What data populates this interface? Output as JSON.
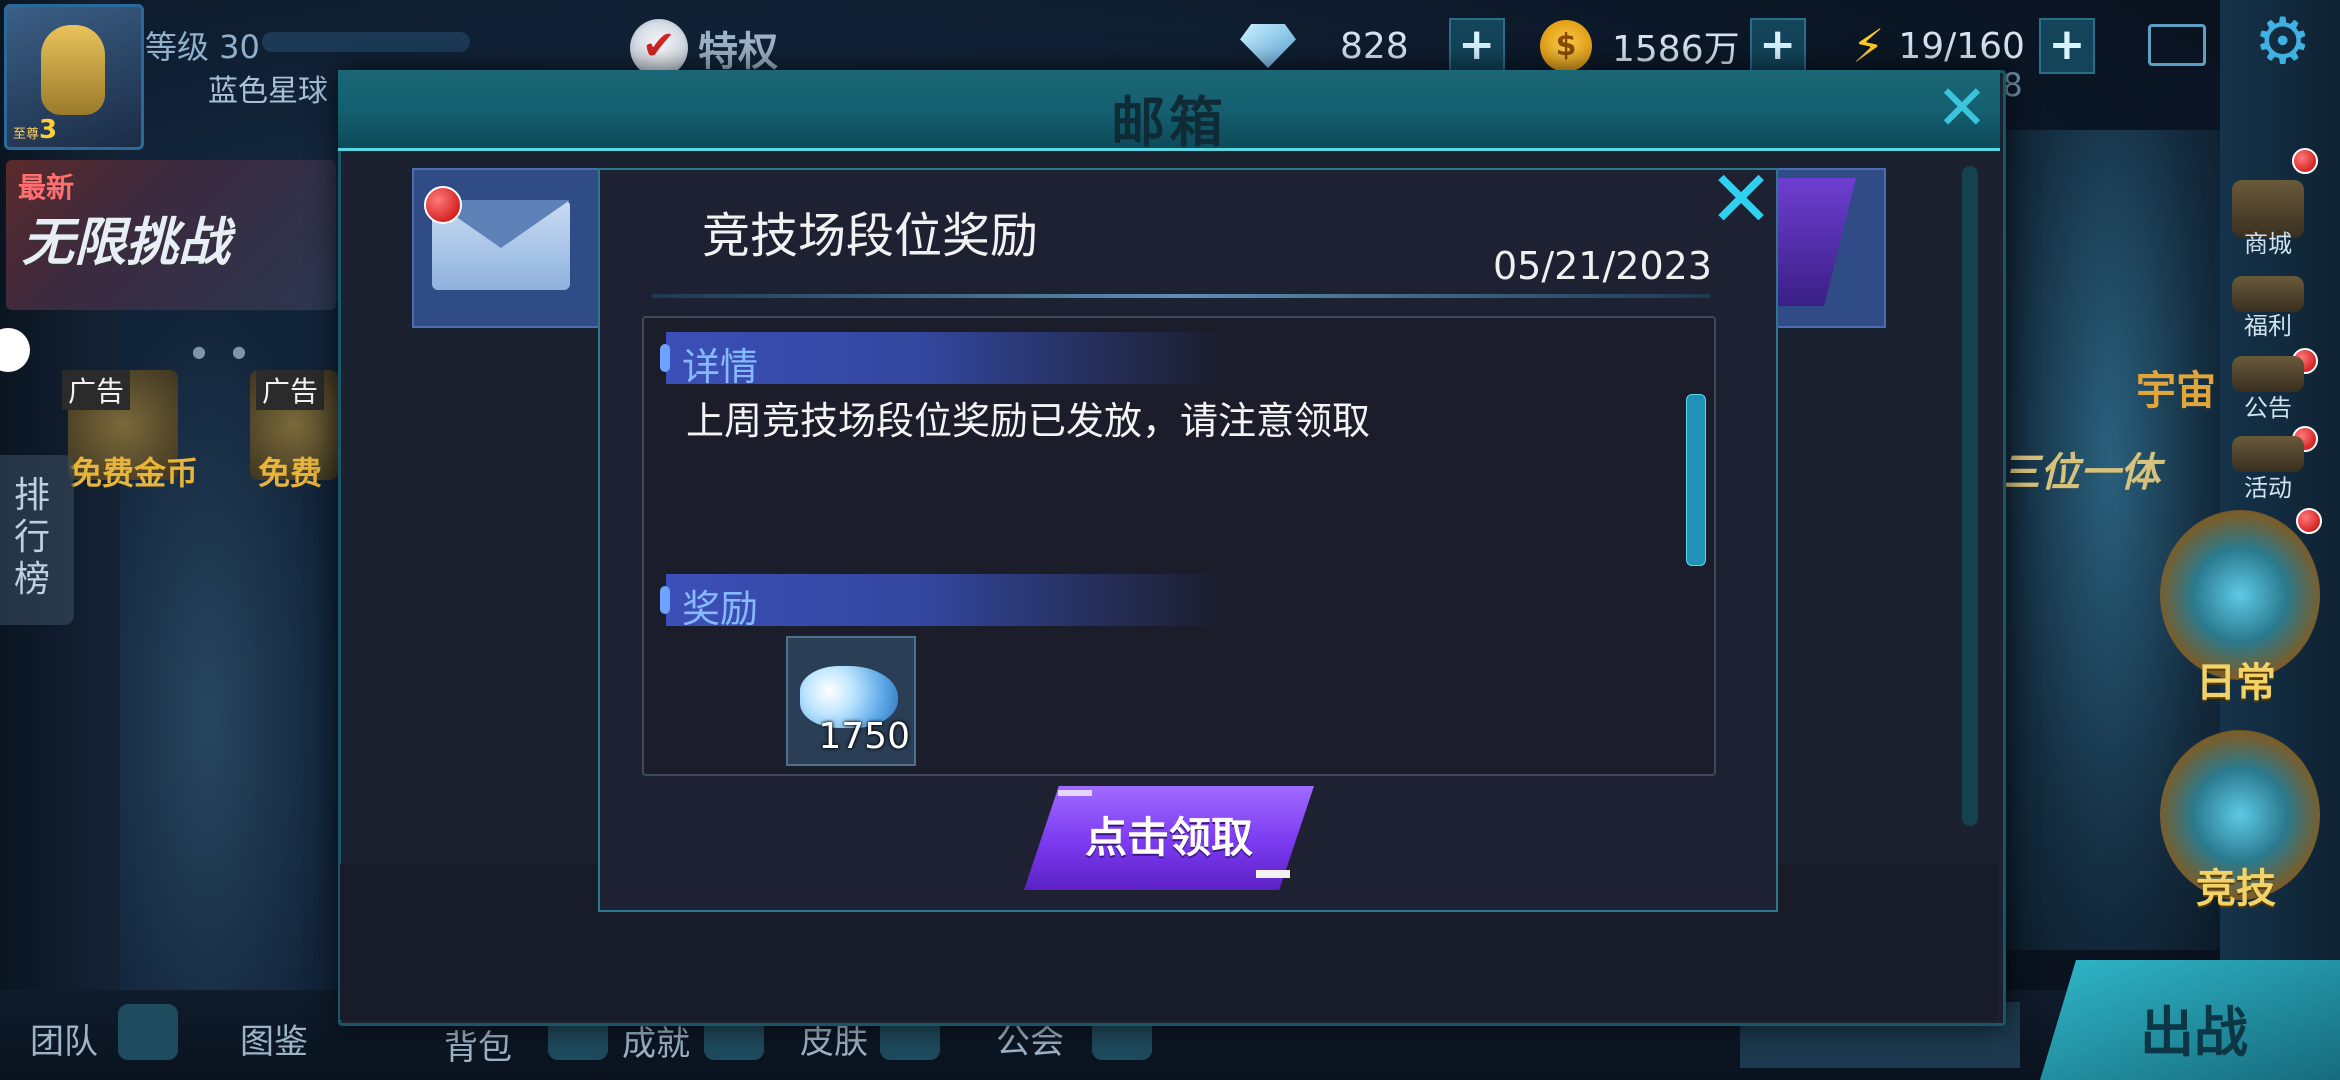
{
  "hud": {
    "level_label": "等级 30",
    "planet": "蓝色星球",
    "rank_small": "至尊",
    "rank_num": "3",
    "privilege": "特权",
    "gems": "828",
    "gold": "1586万",
    "energy": "19/160",
    "energy_sub": "38",
    "plus": "+"
  },
  "left_panel": {
    "newest": "最新",
    "infinite_challenge": "无限挑战",
    "ad_tag": "广告",
    "free_gold": "免费金币",
    "free_other": "免费",
    "rank_tab": "排行榜"
  },
  "right_panel": {
    "shop": "商城",
    "welfare": "福利",
    "notice": "公告",
    "event": "活动",
    "universe_text": "宇宙",
    "three_in_one": "三位一体",
    "daily": "日常",
    "arena": "竞技"
  },
  "bottom_nav": [
    "团队",
    "图鉴",
    "背包",
    "成就",
    "皮肤",
    "公会"
  ],
  "battle": "出战",
  "mailbox": {
    "title": "邮箱",
    "close_symbol": "✕"
  },
  "mail_detail": {
    "title": "竞技场段位奖励",
    "date": "05/21/2023",
    "details_label": "详情",
    "details_text": "上周竞技场段位奖励已发放，请注意领取",
    "reward_label": "奖励",
    "reward_count": "1750",
    "claim_button": "点击领取"
  },
  "colors": {
    "accent_cyan": "#2fd1f0",
    "claim_purple": "#7b39f0",
    "section_blue": "#3b4fb8",
    "notify_red": "#c40000"
  }
}
